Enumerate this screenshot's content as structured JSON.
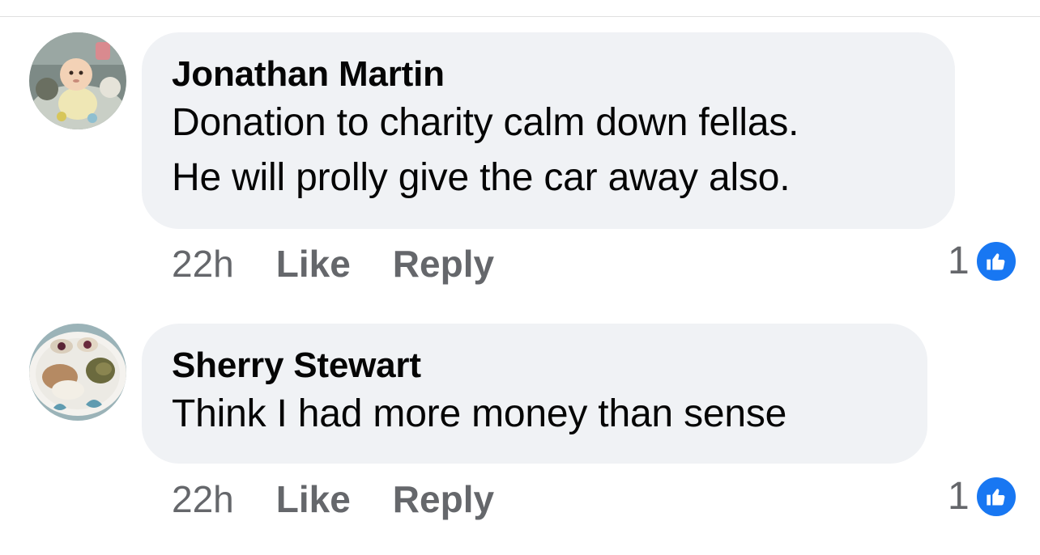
{
  "comments": [
    {
      "author": "Jonathan Martin",
      "text_lines": [
        "Donation to charity calm down fellas.",
        "He will prolly give the car away also."
      ],
      "time": "22h",
      "like_label": "Like",
      "reply_label": "Reply",
      "reaction_count": "1",
      "reaction_icon": "thumbs-up-icon"
    },
    {
      "author": "Sherry Stewart",
      "text_lines": [
        "Think I had more money than sense"
      ],
      "time": "22h",
      "like_label": "Like",
      "reply_label": "Reply",
      "reaction_count": "1",
      "reaction_icon": "thumbs-up-icon"
    }
  ],
  "colors": {
    "bubble_bg": "#f0f2f5",
    "primary_text": "#050505",
    "secondary_text": "#65676b",
    "like_badge": "#1877f2"
  }
}
